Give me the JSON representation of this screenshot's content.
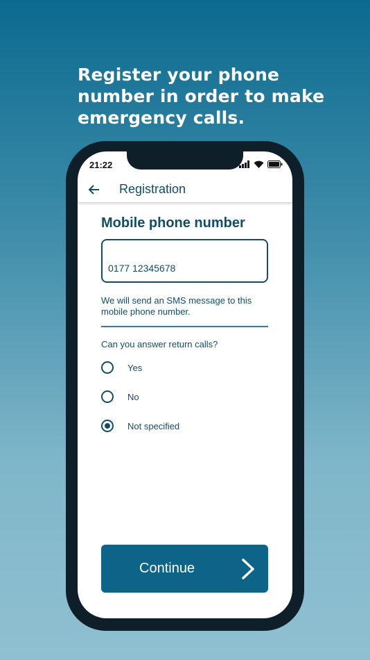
{
  "headline": "Register your phone number in order to make emergency calls.",
  "status_bar": {
    "time": "21:22",
    "icons": [
      "signal-icon",
      "wifi-icon",
      "battery-icon"
    ]
  },
  "appbar": {
    "back_icon": "back-arrow-icon",
    "title": "Registration"
  },
  "form": {
    "section_title": "Mobile phone number",
    "phone_value": "0177 12345678",
    "info_text": "We will send an SMS message to this mobile phone number.",
    "question": "Can you answer return calls?",
    "options": [
      {
        "label": "Yes",
        "selected": false
      },
      {
        "label": "No",
        "selected": false
      },
      {
        "label": "Not specified",
        "selected": true
      }
    ]
  },
  "continue_button": {
    "label": "Continue",
    "icon": "chevron-right-icon"
  },
  "colors": {
    "primary": "#124d66",
    "button": "#0d6488",
    "background_top": "#0b6a8f",
    "background_bottom": "#8fc0d1",
    "frame": "#0e1f2a"
  }
}
